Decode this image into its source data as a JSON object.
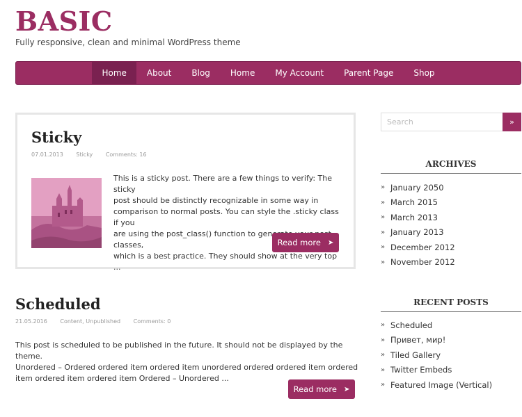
{
  "site": {
    "title": "BASIC",
    "description": "Fully responsive, clean and minimal WordPress theme"
  },
  "nav": {
    "items": [
      "Home",
      "About",
      "Blog",
      "Home",
      "My Account",
      "Parent Page",
      "Shop"
    ],
    "active_index": 0
  },
  "posts": [
    {
      "title": "Sticky",
      "date": "07.01.2013",
      "category": "Sticky",
      "comments": "Comments: 16",
      "excerpt_lines": [
        "This is a sticky post. There are a few things to verify: The sticky",
        "post should be distinctly recognizable in some way in",
        "comparison to normal posts. You can style the .sticky class if you",
        "are using the post_class() function to generate your post classes,",
        "which is a best practice. They should show at the very top ..."
      ],
      "read_more": "Read more",
      "has_thumbnail": true
    },
    {
      "title": "Scheduled",
      "date": "21.05.2016",
      "category": "Content, Unpublished",
      "comments": "Comments: 0",
      "excerpt_lines": [
        "This post is scheduled to be published in the future. It should not be displayed by the theme.",
        "Unordered – Ordered ordered item ordered item unordered ordered ordered item ordered",
        "item ordered item ordered item Ordered – Unordered ..."
      ],
      "read_more": "Read more",
      "has_thumbnail": false
    }
  ],
  "sidebar": {
    "search": {
      "placeholder": "Search",
      "button": "»"
    },
    "archives": {
      "title": "ARCHIVES",
      "items": [
        "January 2050",
        "March 2015",
        "March 2013",
        "January 2013",
        "December 2012",
        "November 2012"
      ]
    },
    "recent_posts": {
      "title": "RECENT POSTS",
      "items": [
        "Scheduled",
        "Привет, мир!",
        "Tiled Gallery",
        "Twitter Embeds",
        "Featured Image (Vertical)"
      ]
    }
  },
  "colors": {
    "accent": "#9b2d62",
    "accent_dark": "#7a2150"
  }
}
